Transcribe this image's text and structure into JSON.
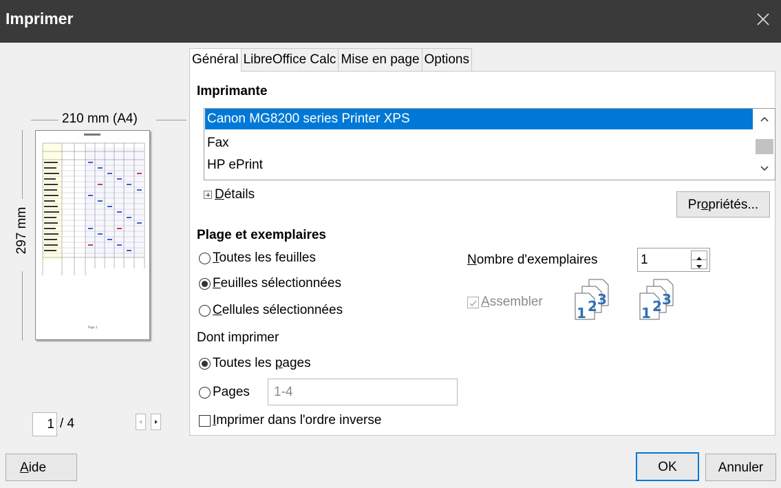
{
  "window": {
    "title": "Imprimer"
  },
  "tabs": [
    {
      "label": "Général",
      "active": true
    },
    {
      "label": "LibreOffice Calc",
      "active": false
    },
    {
      "label": "Mise en page",
      "active": false
    },
    {
      "label": "Options",
      "active": false
    }
  ],
  "printer": {
    "section_title": "Imprimante",
    "items": [
      "Canon MG8200 series Printer XPS",
      "Fax",
      "HP ePrint"
    ],
    "selected_index": 0,
    "details_label_u": "D",
    "details_label_rest": "étails",
    "properties_label_pre": "Pr",
    "properties_label_u": "o",
    "properties_label_post": "priétés..."
  },
  "range": {
    "section_title": "Plage et exemplaires",
    "all_sheets_u": "T",
    "all_sheets_rest": "outes les feuilles",
    "selected_sheets_u": "F",
    "selected_sheets_rest": "euilles sélectionnées",
    "selected_cells_u": "C",
    "selected_cells_rest": "ellules sélectionnées",
    "selected_option": "selected_sheets",
    "include_label": "Dont imprimer",
    "all_pages_pre": "Toutes les ",
    "all_pages_u": "p",
    "all_pages_post": "ages",
    "pages_pre": "Pa",
    "pages_u": "g",
    "pages_post": "es",
    "pages_value": "1-4",
    "reverse_u": "I",
    "reverse_rest": "mprimer dans l'ordre inverse",
    "copies_u": "N",
    "copies_rest": "ombre d'exemplaires",
    "copies_value": "1",
    "collate_u": "A",
    "collate_rest": "ssembler"
  },
  "preview": {
    "width_label": "210 mm (A4)",
    "height_label": "297 mm",
    "current_page": "1",
    "total_pages": "/ 4",
    "footer_text": "Page 1"
  },
  "footer": {
    "help_u": "A",
    "help_rest": "ide",
    "ok_label": "OK",
    "cancel_label": "Annuler"
  },
  "colors": {
    "titlebar": "#3a3a3a",
    "selection": "#0078d7",
    "collate_icon": "#2e6fb5"
  }
}
